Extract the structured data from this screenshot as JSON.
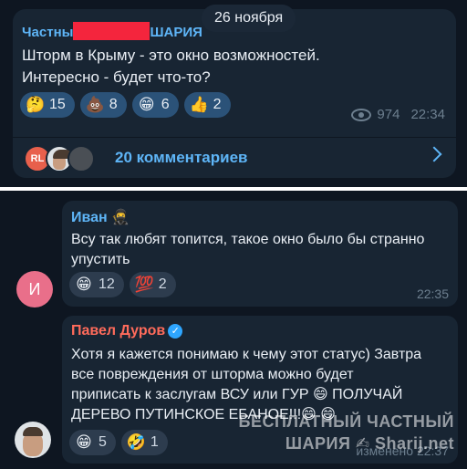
{
  "date_pill": "26 ноября",
  "post": {
    "channel_name_start": "Частны",
    "channel_name_end": "ШАРИЯ",
    "text": "Шторм в Крыму - это окно возможностей.\nИнтересно - будет что-то?",
    "reactions": [
      {
        "emoji": "🤔",
        "count": "15",
        "icon": "thinking-face-icon"
      },
      {
        "emoji": "💩",
        "count": "8",
        "icon": "poop-icon"
      },
      {
        "emoji": "😁",
        "count": "6",
        "icon": "grinning-face-icon"
      },
      {
        "emoji": "👍",
        "count": "2",
        "icon": "thumbs-up-icon"
      }
    ],
    "views": "974",
    "time": "22:34",
    "comment_avatar_initials": "RL",
    "comments_label": "20 комментариев"
  },
  "comments": [
    {
      "author": "Иван 🥷",
      "author_color": "#5eb5f7",
      "avatar_letter": "И",
      "text": "Всу так любят топится, такое окно было бы странно\nупустить",
      "reactions": [
        {
          "emoji": "😁",
          "count": "12",
          "icon": "grinning-face-icon"
        },
        {
          "emoji": "💯",
          "count": "2",
          "icon": "hundred-points-icon"
        }
      ],
      "time": "22:35"
    },
    {
      "author": "Павел Дуров",
      "author_color": "#ff6b5b",
      "verified_glyph": "✓",
      "text": "Хотя я кажется понимаю к чему этот статус) Завтра\nвсе повреждения от шторма можно будет\nприписать к заслугам ВСУ или ГУР 😄 ПОЛУЧАЙ\nДЕРЕВО ПУТИНСКОЕ ЕБАНОЕ!!!😄 😄",
      "reactions": [
        {
          "emoji": "😁",
          "count": "5",
          "icon": "grinning-face-icon"
        },
        {
          "emoji": "🤣",
          "count": "1",
          "icon": "rolling-laughing-icon"
        }
      ],
      "time_prefix": "изменено",
      "time": "22:37"
    }
  ],
  "watermark": {
    "line1": "БЕСПЛАТНЫЙ ЧАСТНЫЙ",
    "line2": "ШАРИЯ ✍ Sharij.net"
  }
}
